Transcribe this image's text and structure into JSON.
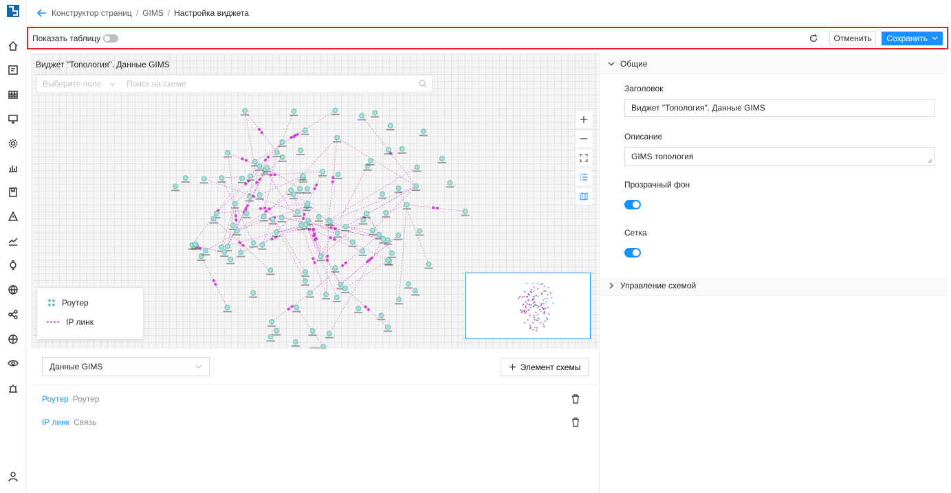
{
  "breadcrumb": {
    "items": [
      "Конструктор страниц",
      "GIMS"
    ],
    "separator": "/",
    "current": "Настройка виджета"
  },
  "toolbar": {
    "show_table_label": "Показать таблицу",
    "show_table_on": false,
    "cancel_label": "Отменить",
    "save_label": "Сохранить"
  },
  "canvas": {
    "title": "Виджет \"Топология\". Данные GIMS",
    "field_placeholder": "Выберите поле",
    "search_placeholder": "Поиск на схеме",
    "legend": [
      {
        "icon": "router-icon",
        "label": "Роутер"
      },
      {
        "icon": "ip-link-dashed-line-icon",
        "label": "IP линк"
      }
    ]
  },
  "lower": {
    "datasource": "Данные GIMS",
    "add_element_label": "Элемент схемы",
    "elements": [
      {
        "name": "Роутер",
        "type": "Роутер"
      },
      {
        "name": "IP линк",
        "type": "Связь"
      }
    ]
  },
  "settings": {
    "general_title": "Общие",
    "heading_label": "Заголовок",
    "heading_value": "Виджет \"Топология\". Данные GIMS",
    "description_label": "Описание",
    "description_value": "GIMS топология",
    "transparent_label": "Прозрачный фон",
    "transparent_on": true,
    "grid_label": "Сетка",
    "grid_on": true,
    "schema_title": "Управление схемой"
  },
  "colors": {
    "accent": "#1890ff",
    "link": "#c040c0",
    "node": "#5bb8b0",
    "frame": "#e02020"
  }
}
